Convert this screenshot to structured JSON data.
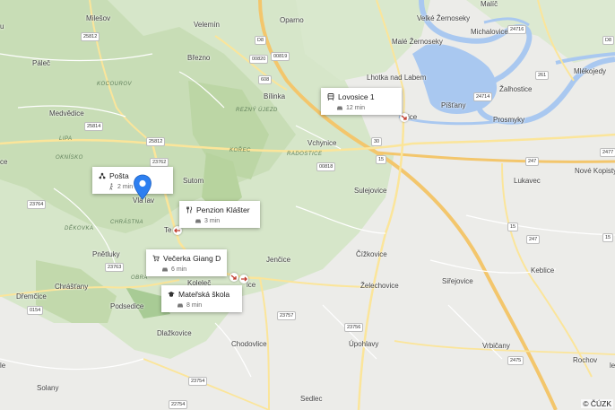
{
  "places": {
    "milesov": "Milešov",
    "velemin": "Velemín",
    "oparno": "Oparno",
    "malic": "Malíč",
    "velke_zernoseky": "Velké Žernoseky",
    "male_zernoseky": "Malé Žernoseky",
    "michalovice": "Michalovice",
    "palec": "Páleč",
    "brezno": "Březno",
    "lhotka": "Lhotka nad Labem",
    "mlekojedy": "Mlékojedy",
    "zalhostice": "Žalhostice",
    "medvedice": "Medvědice",
    "bilinka": "Bílinka",
    "pistany": "Píšťany",
    "prosmyky": "Prosmyky",
    "lovosice_town": "ice",
    "vchynice": "Vchynice",
    "sutom": "Sutom",
    "sulejovice": "Sulejovice",
    "lukavec": "Lukavec",
    "nove_kopisty": "Nové Kopisty",
    "velemin_town": "Vla   lav",
    "te": "Te",
    "pnetluky": "Pnětluky",
    "jencice": "Jenčice",
    "cizkovice": "Čížkovice",
    "keblice": "Keblice",
    "chrastany": "Chrášťany",
    "dremcice": "Dřemčice",
    "kolelec": "Koleleč",
    "ice2": "ice",
    "zelechovice": "Želechovice",
    "sirejovice": "Siřejovice",
    "podsedice": "Podsedice",
    "dlazkovice": "Dlažkovice",
    "chodovlice": "Chodovlice",
    "uporlavy": "Úpohlavy",
    "vrbicany": "Vrbičany",
    "rochov": "Rochov",
    "solany": "Solany",
    "sedlec": "Sedlec",
    "u": "u",
    "ce": "ce",
    "le": "le",
    "le2": "le"
  },
  "area_labels": {
    "kocourov": "KOCOUROV",
    "lipa": "LIPA",
    "oknisko": "OKNÍSKO",
    "rezny_ujezd": "REZNÝ ÚJEZD",
    "korec": "KOŘEC",
    "radostice": "RADOSTICE",
    "chrastna": "CHRÁSTNA",
    "dekovka": "DĚKOVKA",
    "obra": "OBRA"
  },
  "road_shields": {
    "s25812": "25812",
    "s608": "608",
    "s00820": "00820",
    "s00819": "00819",
    "s08": "D8",
    "s24716": "24716",
    "s261": "261",
    "s25814": "25814",
    "s24714": "24714",
    "s25812b": "25812",
    "s00818": "00818",
    "s30": "30",
    "s15": "15",
    "s247": "247",
    "s2477": "2477",
    "s23762": "23762",
    "s23764": "23764",
    "s23763": "23763",
    "s0154": "0154",
    "s23757": "23757",
    "s23756": "23756",
    "s23754": "23754",
    "s2475": "2475",
    "s22754": "22754",
    "s08b": "D8",
    "s15b": "15",
    "s15c": "15",
    "s247b": "247"
  },
  "pois": [
    {
      "id": "lovosice",
      "icon": "train-icon",
      "name": "Lovosice 1",
      "mode": "car",
      "time": "12 min"
    },
    {
      "id": "posta",
      "icon": "post-icon",
      "name": "Pošta",
      "mode": "walk",
      "time": "2 min"
    },
    {
      "id": "penzion",
      "icon": "restaurant-icon",
      "name": "Penzion Klášter",
      "mode": "car",
      "time": "3 min"
    },
    {
      "id": "vecerka",
      "icon": "cart-icon",
      "name": "Večerka Giang Da...",
      "mode": "car",
      "time": "6 min"
    },
    {
      "id": "skola",
      "icon": "school-icon",
      "name": "Mateřská škola",
      "mode": "car",
      "time": "8 min"
    }
  ],
  "attribution": "© ČÚZK",
  "colors": {
    "water": "#a9c8f0",
    "forest": "#cfe2c0",
    "field": "#eeeeec",
    "motorway": "#f3c66c",
    "road": "#fbe59a",
    "marker": "#2d7ff0"
  }
}
